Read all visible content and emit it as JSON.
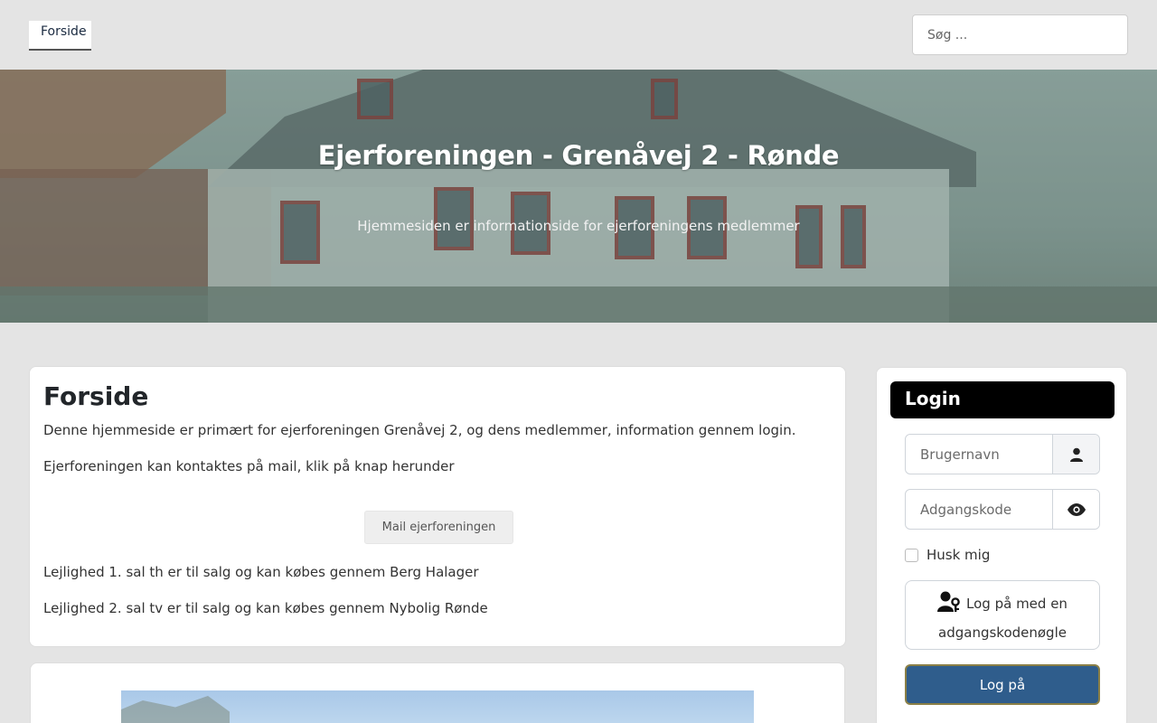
{
  "nav": {
    "home_tab": "Forside"
  },
  "search": {
    "placeholder": "Søg ..."
  },
  "hero": {
    "title": "Ejerforeningen - Grenåvej 2 - Rønde",
    "subtitle": "Hjemmesiden er informationside for ejerforeningens medlemmer"
  },
  "main": {
    "title": "Forside",
    "paragraphs": [
      "Denne hjemmeside er primært for ejerforeningen Grenåvej 2, og dens medlemmer, information gennem login.",
      "Ejerforeningen kan kontaktes på mail, klik på knap herunder"
    ],
    "mail_button": "Mail ejerforeningen",
    "sale_notes": [
      "Lejlighed 1. sal th er til salg og kan købes gennem Berg Halager",
      "Lejlighed 2. sal tv er til salg og kan købes gennem Nybolig Rønde"
    ]
  },
  "login": {
    "title": "Login",
    "username_placeholder": "Brugernavn",
    "password_placeholder": "Adgangskode",
    "remember_label": "Husk mig",
    "passkey_button": "Log på med en adgangskodenøgle",
    "submit_button": "Log på"
  },
  "colors": {
    "background": "#e4e4e4",
    "login_header": "#000000",
    "submit": "#2f5d8c"
  },
  "icons": [
    "user-icon",
    "eye-icon",
    "user-key-icon"
  ]
}
